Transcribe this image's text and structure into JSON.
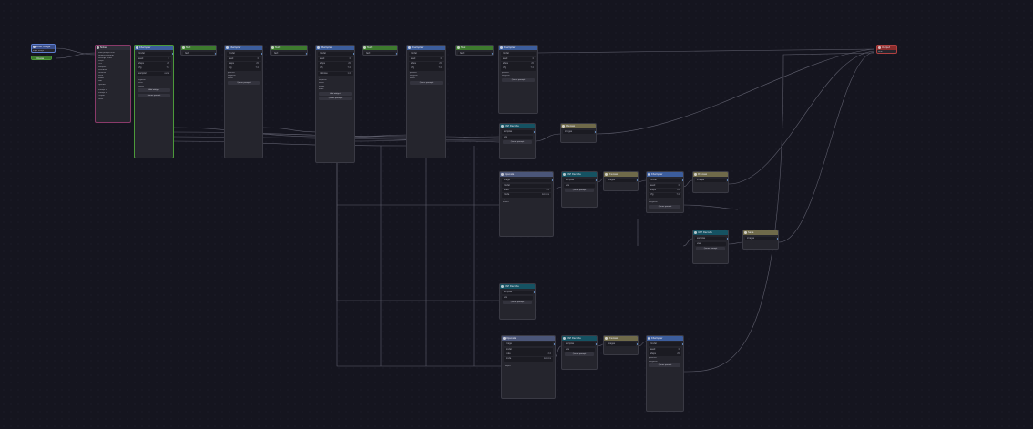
{
  "app": {
    "title": "Node graph editor"
  },
  "colors": {
    "background": "#15151f",
    "node": "#25252d",
    "wire": "#6a6a78"
  },
  "nodes": {
    "load_image": {
      "title": "Load Image",
      "lines": [
        "Input image"
      ]
    },
    "image_out": {
      "title": "Image"
    },
    "notes": {
      "title": "Notes",
      "lines": [
        "Main prompt here",
        "Negative prompt",
        "Settings below",
        "Steps",
        "CFG",
        "Sampler",
        "Scheduler",
        "Denoise",
        "Seed",
        "Model",
        "VAE",
        "Upscale",
        "Prompt 1",
        "Prompt 2",
        "Prompt 3",
        "Output",
        "Done"
      ]
    },
    "sampler_1": {
      "title": "KSampler",
      "rows": [
        [
          "model",
          ""
        ],
        [
          "seed",
          "0"
        ],
        [
          "steps",
          "20"
        ],
        [
          "cfg",
          "7.0"
        ],
        [
          "sampler",
          "euler"
        ]
      ],
      "lines": [
        "positive",
        "negative",
        "latent",
        "control"
      ],
      "buttons": [
        "Add widget",
        "Queue prompt"
      ]
    },
    "text_1": {
      "title": "Text",
      "rows": [
        [
          "text",
          ""
        ]
      ]
    },
    "sampler_2": {
      "title": "KSampler",
      "rows": [
        [
          "model",
          ""
        ],
        [
          "seed",
          "0"
        ],
        [
          "steps",
          "20"
        ],
        [
          "cfg",
          "7.0"
        ]
      ],
      "lines": [
        "positive",
        "negative",
        "latent"
      ],
      "buttons": [
        "Queue prompt"
      ]
    },
    "text_2": {
      "title": "Text",
      "rows": [
        [
          "text",
          ""
        ]
      ]
    },
    "sampler_3": {
      "title": "KSampler",
      "rows": [
        [
          "model",
          ""
        ],
        [
          "seed",
          "0"
        ],
        [
          "steps",
          "20"
        ],
        [
          "cfg",
          "7.0"
        ],
        [
          "denoise",
          "1.0"
        ]
      ],
      "lines": [
        "positive",
        "negative",
        "latent",
        "image",
        "mask"
      ],
      "buttons": [
        "Add widget",
        "Queue prompt"
      ]
    },
    "text_3": {
      "title": "Text",
      "rows": [
        [
          "text",
          ""
        ]
      ]
    },
    "sampler_4": {
      "title": "KSampler",
      "rows": [
        [
          "model",
          ""
        ],
        [
          "seed",
          "0"
        ],
        [
          "steps",
          "20"
        ],
        [
          "cfg",
          "7.0"
        ]
      ],
      "lines": [
        "positive",
        "negative",
        "latent"
      ],
      "buttons": [
        "Queue prompt"
      ]
    },
    "text_4": {
      "title": "Text",
      "rows": [
        [
          "text",
          ""
        ]
      ]
    },
    "sampler_5": {
      "title": "KSampler",
      "rows": [
        [
          "model",
          ""
        ],
        [
          "seed",
          "0"
        ],
        [
          "steps",
          "20"
        ],
        [
          "cfg",
          "7.0"
        ]
      ],
      "lines": [
        "positive",
        "negative"
      ],
      "buttons": [
        "Queue prompt"
      ]
    },
    "decode_1": {
      "title": "VAE Decode",
      "rows": [
        [
          "samples",
          ""
        ],
        [
          "vae",
          ""
        ]
      ],
      "buttons": [
        "Queue prompt"
      ]
    },
    "preview_1": {
      "title": "Preview",
      "rows": [
        [
          "images",
          ""
        ]
      ]
    },
    "upscale_a": {
      "title": "Upscale",
      "rows": [
        [
          "image",
          ""
        ],
        [
          "model",
          ""
        ],
        [
          "scale",
          "2.0"
        ],
        [
          "mode",
          "lanczos"
        ]
      ],
      "lines": [
        "upscale",
        "output"
      ]
    },
    "decode_2": {
      "title": "VAE Decode",
      "rows": [
        [
          "samples",
          ""
        ],
        [
          "vae",
          ""
        ]
      ],
      "buttons": [
        "Queue prompt"
      ]
    },
    "preview_2": {
      "title": "Preview",
      "rows": [
        [
          "images",
          ""
        ]
      ]
    },
    "sampler_6": {
      "title": "KSampler",
      "rows": [
        [
          "model",
          ""
        ],
        [
          "seed",
          "0"
        ],
        [
          "steps",
          "20"
        ],
        [
          "cfg",
          "7.0"
        ]
      ],
      "lines": [
        "positive",
        "negative"
      ],
      "buttons": [
        "Queue prompt"
      ]
    },
    "preview_3": {
      "title": "Preview",
      "rows": [
        [
          "images",
          ""
        ]
      ]
    },
    "decode_3": {
      "title": "VAE Decode",
      "rows": [
        [
          "samples",
          ""
        ],
        [
          "vae",
          ""
        ]
      ],
      "buttons": [
        "Queue prompt"
      ]
    },
    "save_1": {
      "title": "Save",
      "rows": [
        [
          "images",
          ""
        ]
      ]
    },
    "decode_4": {
      "title": "VAE Decode",
      "rows": [
        [
          "samples",
          ""
        ],
        [
          "vae",
          ""
        ]
      ],
      "buttons": [
        "Queue prompt"
      ]
    },
    "upscale_b": {
      "title": "Upscale",
      "rows": [
        [
          "image",
          ""
        ],
        [
          "model",
          ""
        ],
        [
          "scale",
          "2.0"
        ],
        [
          "mode",
          "lanczos"
        ]
      ],
      "lines": [
        "upscale",
        "output"
      ]
    },
    "decode_5": {
      "title": "VAE Decode",
      "rows": [
        [
          "samples",
          ""
        ],
        [
          "vae",
          ""
        ]
      ],
      "buttons": [
        "Queue prompt"
      ]
    },
    "preview_4": {
      "title": "Preview",
      "rows": [
        [
          "images",
          ""
        ]
      ]
    },
    "sampler_7": {
      "title": "KSampler",
      "rows": [
        [
          "model",
          ""
        ],
        [
          "seed",
          "0"
        ],
        [
          "steps",
          "20"
        ]
      ],
      "lines": [
        "positive",
        "negative"
      ],
      "buttons": [
        "Queue prompt"
      ]
    },
    "output": {
      "title": "Output",
      "lines": [
        "Final"
      ]
    }
  }
}
